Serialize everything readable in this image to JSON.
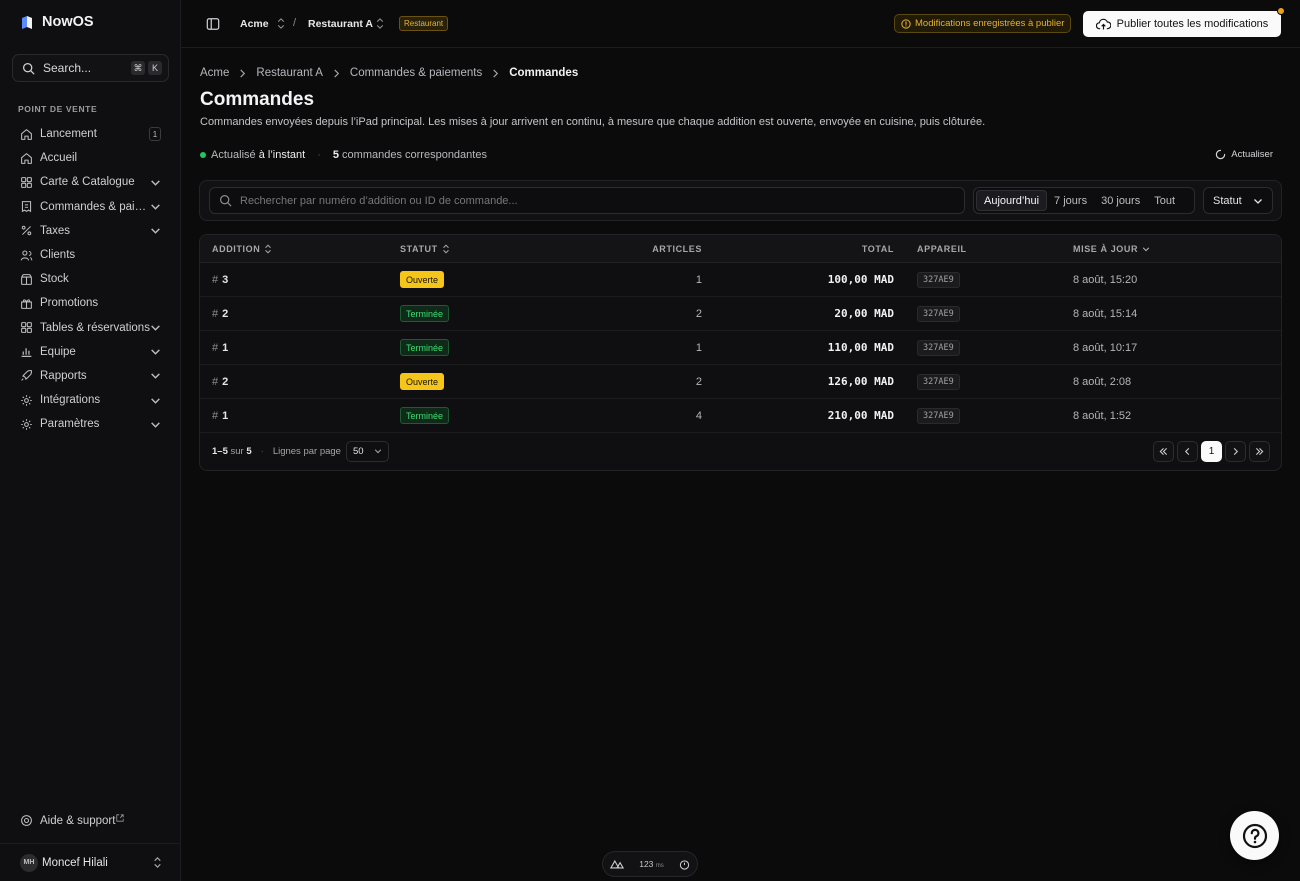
{
  "app": {
    "name": "NowOS"
  },
  "sidebar": {
    "search_label": "Search...",
    "search_kbd": [
      "⌘",
      "K"
    ],
    "section": "POINT DE VENTE",
    "items": [
      {
        "label": "Lancement",
        "icon": "home-icon",
        "badge": "1",
        "expandable": false
      },
      {
        "label": "Accueil",
        "icon": "home-icon",
        "expandable": false
      },
      {
        "label": "Carte & Catalogue",
        "icon": "grid-icon",
        "expandable": true
      },
      {
        "label": "Commandes & paiements",
        "icon": "receipt-icon",
        "expandable": true
      },
      {
        "label": "Taxes",
        "icon": "percent-icon",
        "expandable": true
      },
      {
        "label": "Clients",
        "icon": "users-icon",
        "expandable": false
      },
      {
        "label": "Stock",
        "icon": "box-icon",
        "expandable": false
      },
      {
        "label": "Promotions",
        "icon": "gift-icon",
        "expandable": false
      },
      {
        "label": "Tables & réservations",
        "icon": "grid-icon",
        "expandable": true
      },
      {
        "label": "Équipe",
        "icon": "chart-icon",
        "expandable": true
      },
      {
        "label": "Rapports",
        "icon": "rocket-icon",
        "expandable": true
      },
      {
        "label": "Intégrations",
        "icon": "gear-icon",
        "expandable": true
      },
      {
        "label": "Paramètres",
        "icon": "gear-icon",
        "expandable": true
      }
    ],
    "help_label": "Aide & support",
    "user": {
      "initials": "MH",
      "name": "Moncef Hilali"
    }
  },
  "topbar": {
    "org": "Acme",
    "separator": "/",
    "restaurant": "Restaurant A",
    "type_badge": "Restaurant",
    "pending_label": "Modifications enregistrées à publier",
    "publish_label": "Publier toutes les modifications"
  },
  "breadcrumb": [
    "Acme",
    "Restaurant A",
    "Commandes & paiements",
    "Commandes"
  ],
  "page": {
    "title": "Commandes",
    "subtitle": "Commandes envoyées depuis l’iPad principal. Les mises à jour arrivent en continu, à mesure que chaque addition est ouverte, envoyée en cuisine, puis clôturée.",
    "live_prefix": "Actualisé",
    "live_time": "à l’instant",
    "match_count": "5",
    "match_label": "commandes correspondantes",
    "refresh_label": "Actualiser"
  },
  "filters": {
    "search_placeholder": "Rechercher par numéro d’addition ou ID de commande...",
    "ranges": [
      "Aujourd’hui",
      "7 jours",
      "30 jours",
      "Tout"
    ],
    "active_range": "Aujourd’hui",
    "status_label": "Statut"
  },
  "table": {
    "headers": {
      "addition": "ADDITION",
      "status": "STATUT",
      "articles": "ARTICLES",
      "total": "TOTAL",
      "device": "APPAREIL",
      "updated": "MISE À JOUR"
    },
    "rows": [
      {
        "addition": "3",
        "status": "Ouverte",
        "articles": "1",
        "total": "100,00 MAD",
        "device": "327AE9",
        "updated": "8 août, 15:20"
      },
      {
        "addition": "2",
        "status": "Terminée",
        "articles": "2",
        "total": "20,00 MAD",
        "device": "327AE9",
        "updated": "8 août, 15:14"
      },
      {
        "addition": "1",
        "status": "Terminée",
        "articles": "1",
        "total": "110,00 MAD",
        "device": "327AE9",
        "updated": "8 août, 10:17"
      },
      {
        "addition": "2",
        "status": "Ouverte",
        "articles": "2",
        "total": "126,00 MAD",
        "device": "327AE9",
        "updated": "8 août, 2:08"
      },
      {
        "addition": "1",
        "status": "Terminée",
        "articles": "4",
        "total": "210,00 MAD",
        "device": "327AE9",
        "updated": "8 août, 1:52"
      }
    ],
    "footer": {
      "range": "1–5",
      "of_word": "sur",
      "total": "5",
      "rows_per_page_label": "Lignes par page",
      "rows_per_page": "50",
      "current_page": "1"
    }
  },
  "devbar": {
    "value": "123",
    "unit": "ms"
  },
  "colors": {
    "accent_open": "#f5c518",
    "accent_done": "#3ddc74",
    "warning": "#e6b32e",
    "live": "#22c55e"
  }
}
